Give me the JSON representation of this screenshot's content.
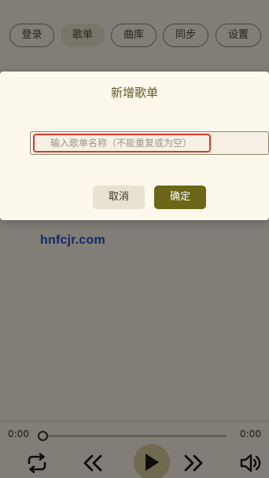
{
  "nav": {
    "tabs": [
      {
        "label": "登录"
      },
      {
        "label": "歌单"
      },
      {
        "label": "曲库"
      },
      {
        "label": "同步"
      },
      {
        "label": "设置"
      }
    ],
    "active_tab": "歌单"
  },
  "watermark": "hnfcjr.com",
  "player": {
    "current_time": "0:00",
    "total_time": "0:00",
    "progress": 0,
    "controls": [
      "repeat-icon",
      "previous-icon",
      "play-icon",
      "next-icon",
      "volume-icon"
    ]
  },
  "dialog": {
    "title": "新增歌单",
    "input": {
      "value": "",
      "placeholder": "输入歌单名称（不能重复或为空）"
    },
    "cancel_label": "取消",
    "confirm_label": "确定"
  },
  "colors": {
    "accent": "#6b6618",
    "highlight_border": "#d63a2a",
    "watermark": "#2448c8"
  }
}
